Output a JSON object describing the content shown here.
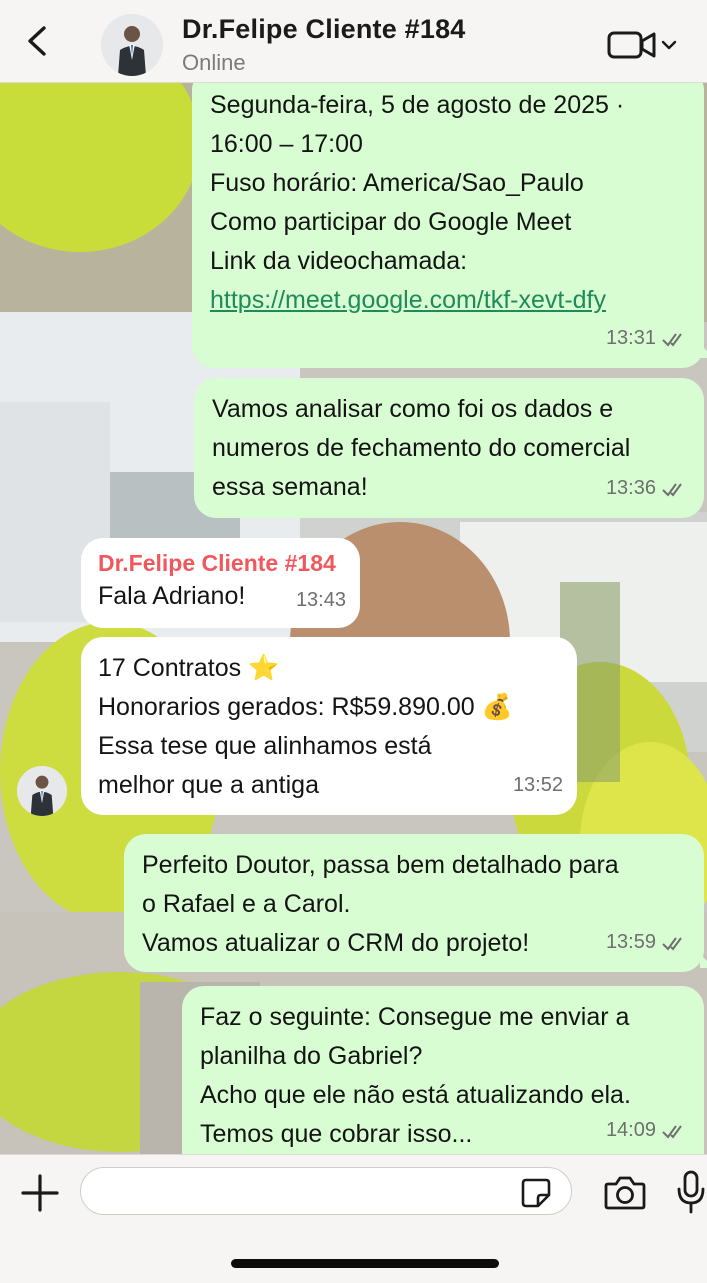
{
  "header": {
    "contact_name": "Dr.Felipe Cliente #184",
    "status": "Online"
  },
  "messages": [
    {
      "direction": "outgoing",
      "lines": [
        "Segunda-feira, 5 de agosto de 2025 ·",
        "16:00 – 17:00",
        "Fuso horário: America/Sao_Paulo",
        "Como participar do Google Meet",
        "Link da videochamada:"
      ],
      "link": "https://meet.google.com/tkf-xevt-dfy",
      "time": "13:31",
      "ticks": "read"
    },
    {
      "direction": "outgoing",
      "lines": [
        "Vamos analisar como foi os dados e",
        "numeros de fechamento do comercial",
        "essa semana!"
      ],
      "time": "13:36",
      "ticks": "read"
    },
    {
      "direction": "incoming",
      "sender": "Dr.Felipe Cliente #184",
      "lines": [
        "Fala Adriano!"
      ],
      "time": "13:43"
    },
    {
      "direction": "incoming",
      "lines": [
        "17 Contratos ⭐",
        "Honorarios gerados: R$59.890.00 💰",
        "Essa tese que alinhamos está",
        "melhor que a antiga"
      ],
      "time": "13:52"
    },
    {
      "direction": "outgoing",
      "lines": [
        "Perfeito Doutor, passa bem detalhado para",
        "o Rafael e a Carol.",
        "Vamos atualizar o CRM do projeto!"
      ],
      "time": "13:59",
      "ticks": "read"
    },
    {
      "direction": "outgoing",
      "lines": [
        "Faz o seguinte: Consegue me enviar a",
        "planilha do Gabriel?",
        "Acho que ele não está atualizando ela.",
        "Temos que cobrar isso..."
      ],
      "time": "14:09",
      "ticks": "read"
    }
  ],
  "composer": {
    "value": "",
    "placeholder": ""
  },
  "colors": {
    "outgoing_bubble": "#d9fdd3",
    "incoming_bubble": "#ffffff",
    "sender_name": "#f0585d",
    "link": "#1f8a5a",
    "bar_background": "#f6f5f3"
  },
  "icons": {
    "back": "chevron-left-icon",
    "video": "video-camera-icon",
    "plus": "plus-icon",
    "sticker": "sticker-icon",
    "camera": "camera-icon",
    "mic": "microphone-icon",
    "ticks": "double-check-icon"
  }
}
